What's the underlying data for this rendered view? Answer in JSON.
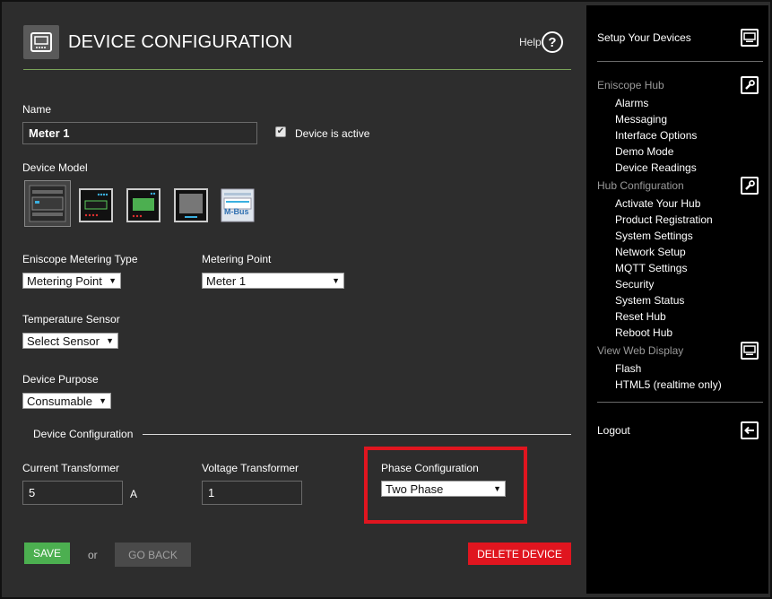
{
  "header": {
    "title": "DEVICE CONFIGURATION",
    "help_label": "Help",
    "help_icon": "question-circle-icon"
  },
  "form": {
    "name_label": "Name",
    "name_value": "Meter 1",
    "active_label": "Device is active",
    "active_checked": true,
    "device_model_label": "Device Model",
    "device_models": [
      "din-rail-meter",
      "panel-meter-leds",
      "panel-meter-green",
      "panel-meter-gray",
      "m-bus-meter"
    ],
    "mbus_text": "M-Bus",
    "metering_type_label": "Eniscope Metering Type",
    "metering_type_value": "Metering Point",
    "metering_point_label": "Metering Point",
    "metering_point_value": "Meter 1",
    "temperature_label": "Temperature Sensor",
    "temperature_value": "Select Sensor",
    "purpose_label": "Device Purpose",
    "purpose_value": "Consumable",
    "section_title": "Device Configuration",
    "ct_label": "Current Transformer",
    "ct_value": "5",
    "ct_unit": "A",
    "vt_label": "Voltage Transformer",
    "vt_value": "1",
    "phase_label": "Phase Configuration",
    "phase_value": "Two Phase"
  },
  "buttons": {
    "save": "SAVE",
    "or": "or",
    "go_back": "GO BACK",
    "delete": "DELETE DEVICE"
  },
  "sidebar": {
    "setup_devices": "Setup Your Devices",
    "hub_group": "Eniscope Hub",
    "hub_items": [
      "Alarms",
      "Messaging",
      "Interface Options",
      "Demo Mode",
      "Device Readings"
    ],
    "hub_config_group": "Hub Configuration",
    "hub_config_items": [
      "Activate Your Hub",
      "Product Registration",
      "System Settings",
      "Network Setup",
      "MQTT Settings",
      "Security",
      "System Status",
      "Reset Hub",
      "Reboot Hub"
    ],
    "web_display_group": "View Web Display",
    "web_display_items": [
      "Flash",
      "HTML5 (realtime only)"
    ],
    "logout": "Logout"
  },
  "colors": {
    "accent_green": "#4caf50",
    "danger_red": "#e0151f",
    "highlight_red": "#e0151f",
    "header_rule": "#7aa35a"
  }
}
